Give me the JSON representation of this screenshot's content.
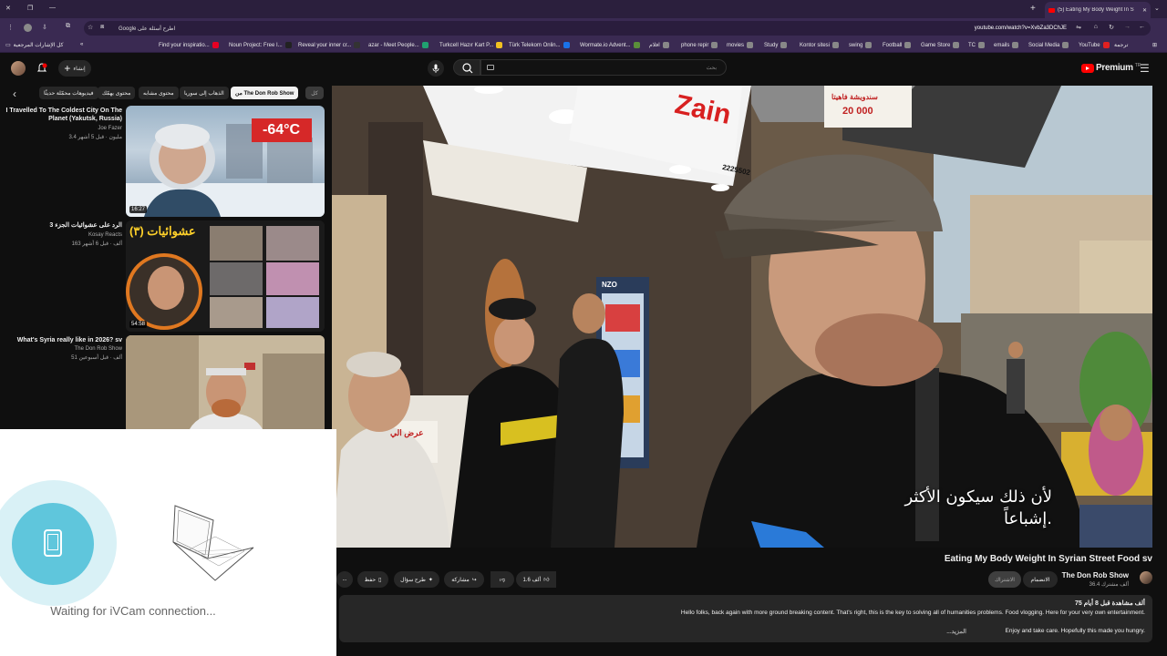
{
  "browser": {
    "tab_title": "(5) Eating My Body Weight In S",
    "url": "youtube.com/watch?v=XvbZa3DChJE",
    "search_prefill": "Google اطرح أسئلة على",
    "bookmarks": [
      {
        "label": "YouTube",
        "color": "#e02020"
      },
      {
        "label": "Social Media",
        "color": "#888"
      },
      {
        "label": "emails",
        "color": "#888"
      },
      {
        "label": "TC",
        "color": "#888"
      },
      {
        "label": "Game Store",
        "color": "#888"
      },
      {
        "label": "Football",
        "color": "#888"
      },
      {
        "label": "swing",
        "color": "#888"
      },
      {
        "label": "Kontor sitesi",
        "color": "#888"
      },
      {
        "label": "Study",
        "color": "#888"
      },
      {
        "label": "movies",
        "color": "#888"
      },
      {
        "label": "phone repir",
        "color": "#888"
      },
      {
        "label": "افلام",
        "color": "#888"
      },
      {
        "label": "Wormate.io Advent...",
        "color": "#5a8f3a"
      },
      {
        "label": "Türk Telekom Onlin...",
        "color": "#1a73e8"
      },
      {
        "label": "Turkcell Hazır Kart P...",
        "color": "#f0c020"
      },
      {
        "label": "azar - Meet People...",
        "color": "#20a070"
      },
      {
        "label": "Reveal your inner cr...",
        "color": "#333"
      },
      {
        "label": "Noun Project: Free I...",
        "color": "#222"
      },
      {
        "label": "Find your inspiratio...",
        "color": "#e60023"
      }
    ],
    "bookmarks_all": "كل الإشارات المرجعية",
    "translate_label": "ترجمة"
  },
  "youtube": {
    "logo": "Premium",
    "logo_sup": "TR",
    "search_placeholder": "بحث",
    "create_label": "إنشاء",
    "notif_count": "9+"
  },
  "chips": [
    "من The Don Rob Show",
    "الذهاب إلى سوريا",
    "محتوى مشابه",
    "محتوى يهمّك",
    "فيديوهات محمّلة حديثًا"
  ],
  "related": [
    {
      "title": "I Travelled To The Coldest City On The Planet (Yakutsk, Russia)",
      "channel": "Joe Fazer",
      "meta": "3.4 مليون · قبل 5 أشهر",
      "duration": "16:27",
      "thumb_text": "-64°C"
    },
    {
      "title": "الرد على عشوائيات الجزء 3",
      "channel": "Kosay Reacts",
      "meta": "163 ألف · قبل 6 أشهر",
      "duration": "54:58",
      "thumb_text": "عشوائيات (٣)"
    },
    {
      "title": "What's Syria really like in 2026? sv",
      "channel": "The Don Rob Show",
      "meta": "51 ألف · قبل أسبوعين",
      "duration": "",
      "thumb_text": ""
    }
  ],
  "player": {
    "subtitle_line1": "لأن ذلك سيكون الأكثر",
    "subtitle_line2": "إشباعاً.",
    "shop_sign": "Zain",
    "shop_phone": "2225502",
    "price_sign": "20 000",
    "price_sign_text": "سندويشة فاهيتا",
    "offer_sign": "عرض الي",
    "fridge_brand": "NZO"
  },
  "ivcam": {
    "status": "Waiting for iVCam connection..."
  },
  "video": {
    "title": "Eating My Body Weight In Syrian Street Food sv",
    "channel": "The Don Rob Show",
    "subscribers": "36.4 ألف مشترك",
    "join_label": "الانضمام",
    "subscribe_label": "الاشتراك",
    "likes": "1.6 ألف",
    "share_label": "مشاركة",
    "ask_label": "طرح سؤال",
    "save_label": "حفظ",
    "more_label": "...",
    "views_line": "75 ألف مشاهدة قبل 8 أيام",
    "description1": "Hello folks, back again with more ground breaking content. That's right, this is the key to solving all of humanities problems. Food vlogging. Here for your very own entertainment.",
    "description2": "Enjoy and take care. Hopefully this made you hungry.",
    "more_text": "...المزيد"
  }
}
